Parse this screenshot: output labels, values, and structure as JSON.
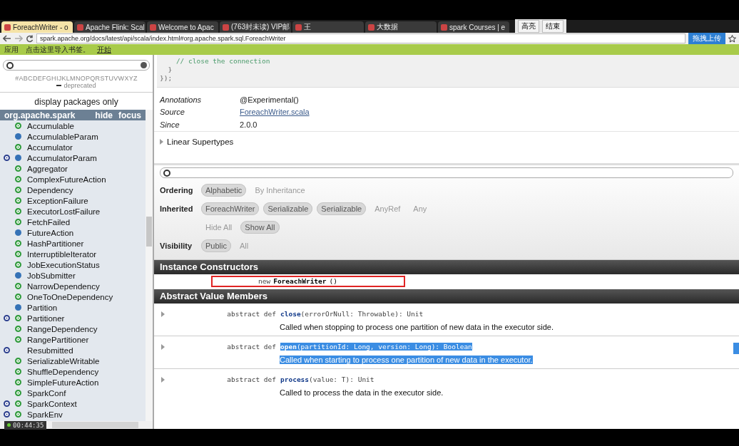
{
  "browser": {
    "tabs": [
      {
        "title": "ForeachWriter - o",
        "selected": true
      },
      {
        "title": "Apache Flink: Scal",
        "selected": false
      },
      {
        "title": "Welcome to Apac",
        "selected": false
      },
      {
        "title": "(763封未读) VIP邮",
        "selected": false
      },
      {
        "title": "王",
        "selected": false
      },
      {
        "title": "大数据",
        "selected": false
      },
      {
        "title": "spark Courses | e",
        "selected": false
      }
    ],
    "recorder_buttons": [
      "高亮",
      "结束"
    ],
    "address": "spark.apache.org/docs/latest/api/scala/index.html#org.apache.spark.sql.ForeachWriter",
    "upload_button": "拖拽上传",
    "bookmarks": [
      "应用",
      "点击这里导入书签。",
      "开始"
    ]
  },
  "sidebar": {
    "letters": "#ABCDEFGHIJKLMNOPQRSTUVWXYZ",
    "deprecated": "deprecated",
    "packages_toggle": "display packages only",
    "package": {
      "name": "org.apache.spark",
      "actions": [
        "hide",
        "focus"
      ]
    },
    "items": [
      {
        "name": "Accumulable",
        "kind": "class",
        "object": false
      },
      {
        "name": "AccumulableParam",
        "kind": "trait",
        "object": false
      },
      {
        "name": "Accumulator",
        "kind": "class",
        "object": false
      },
      {
        "name": "AccumulatorParam",
        "kind": "trait",
        "object": true
      },
      {
        "name": "Aggregator",
        "kind": "class",
        "object": false
      },
      {
        "name": "ComplexFutureAction",
        "kind": "class",
        "object": false
      },
      {
        "name": "Dependency",
        "kind": "class",
        "object": false
      },
      {
        "name": "ExceptionFailure",
        "kind": "class",
        "object": false
      },
      {
        "name": "ExecutorLostFailure",
        "kind": "class",
        "object": false
      },
      {
        "name": "FetchFailed",
        "kind": "class",
        "object": false
      },
      {
        "name": "FutureAction",
        "kind": "trait",
        "object": false
      },
      {
        "name": "HashPartitioner",
        "kind": "class",
        "object": false
      },
      {
        "name": "InterruptibleIterator",
        "kind": "class",
        "object": false
      },
      {
        "name": "JobExecutionStatus",
        "kind": "class",
        "object": false
      },
      {
        "name": "JobSubmitter",
        "kind": "trait",
        "object": false
      },
      {
        "name": "NarrowDependency",
        "kind": "class",
        "object": false
      },
      {
        "name": "OneToOneDependency",
        "kind": "class",
        "object": false
      },
      {
        "name": "Partition",
        "kind": "trait",
        "object": false
      },
      {
        "name": "Partitioner",
        "kind": "class",
        "object": true
      },
      {
        "name": "RangeDependency",
        "kind": "class",
        "object": false
      },
      {
        "name": "RangePartitioner",
        "kind": "class",
        "object": false
      },
      {
        "name": "Resubmitted",
        "kind": "none",
        "object": true
      },
      {
        "name": "SerializableWritable",
        "kind": "class",
        "object": false
      },
      {
        "name": "ShuffleDependency",
        "kind": "class",
        "object": false
      },
      {
        "name": "SimpleFutureAction",
        "kind": "class",
        "object": false
      },
      {
        "name": "SparkConf",
        "kind": "class",
        "object": false
      },
      {
        "name": "SparkContext",
        "kind": "class",
        "object": true
      },
      {
        "name": "SparkEnv",
        "kind": "class",
        "object": true
      }
    ]
  },
  "recording_time": "00:44:35",
  "code_lines": [
    "    // close the connection",
    "  }",
    "});"
  ],
  "attributes": [
    {
      "label": "Annotations",
      "value": "@Experimental()",
      "link": false
    },
    {
      "label": "Source",
      "value": "ForeachWriter.scala",
      "link": true
    },
    {
      "label": "Since",
      "value": "2.0.0",
      "link": false
    }
  ],
  "linear_supertypes": "Linear Supertypes",
  "filters": [
    {
      "label": "Ordering",
      "options": [
        {
          "text": "Alphabetic",
          "selected": true
        },
        {
          "text": "By Inheritance",
          "selected": false
        }
      ]
    },
    {
      "label": "Inherited",
      "options": [
        {
          "text": "ForeachWriter",
          "selected": true
        },
        {
          "text": "Serializable",
          "selected": true
        },
        {
          "text": "Serializable",
          "selected": true
        },
        {
          "text": "AnyRef",
          "selected": false
        },
        {
          "text": "Any",
          "selected": false
        }
      ]
    },
    {
      "options": [
        {
          "text": "Hide All",
          "selected": false
        },
        {
          "text": "Show All",
          "selected": true
        }
      ]
    },
    {
      "label": "Visibility",
      "options": [
        {
          "text": "Public",
          "selected": true
        },
        {
          "text": "All",
          "selected": false
        }
      ]
    }
  ],
  "constructors": {
    "title": "Instance Constructors",
    "items": [
      {
        "prefix": "new",
        "name": "ForeachWriter",
        "params": "()",
        "highlighted": true
      }
    ]
  },
  "members": {
    "title": "Abstract Value Members",
    "items": [
      {
        "prefix": "abstract def",
        "name": "close",
        "signature": "(errorOrNull: Throwable): Unit",
        "comment": "Called when stopping to process one partition of new data in the executor side.",
        "selected": false
      },
      {
        "prefix": "abstract def",
        "name": "open",
        "signature": "(partitionId: Long, version: Long): Boolean",
        "comment": "Called when starting to process one partition of new data in the executor.",
        "selected": true
      },
      {
        "prefix": "abstract def",
        "name": "process",
        "signature": "(value: T): Unit",
        "comment": "Called to process the data in the executor side.",
        "selected": false
      }
    ]
  }
}
